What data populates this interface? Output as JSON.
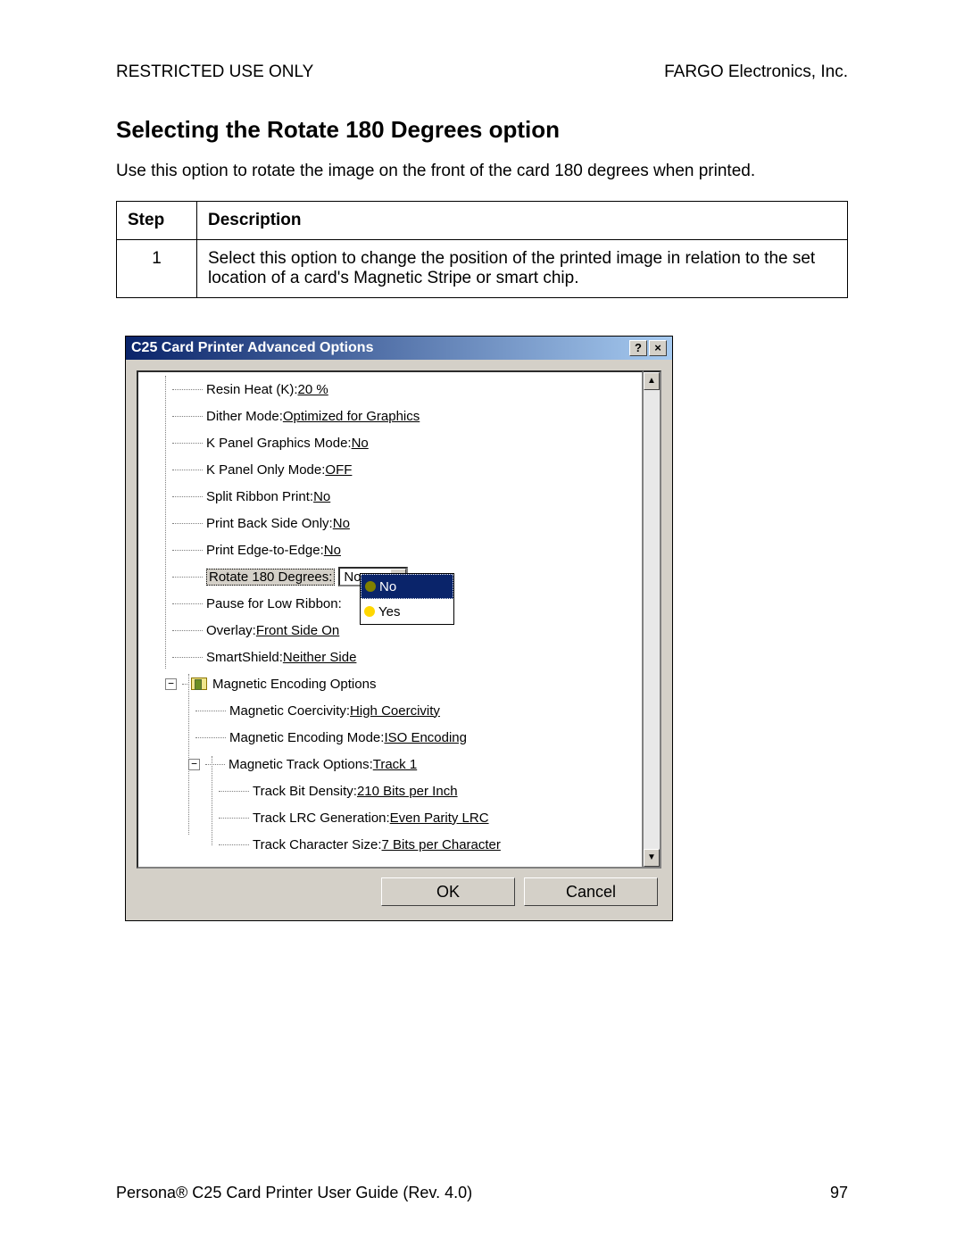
{
  "header": {
    "left": "RESTRICTED USE ONLY",
    "right": "FARGO Electronics, Inc."
  },
  "title": "Selecting the Rotate 180 Degrees option",
  "intro": "Use this option to rotate the image on the front of the card 180 degrees when printed.",
  "table": {
    "hdr_step": "Step",
    "hdr_desc": "Description",
    "row1_step": "1",
    "row1_desc": "Select this option to change the position of the printed image in relation to the set location of a card's Magnetic Stripe or smart chip."
  },
  "dialog": {
    "title": "C25 Card Printer Advanced Options",
    "help": "?",
    "close": "×",
    "scroll_up": "▲",
    "scroll_down": "▼",
    "expand": "−",
    "ok": "OK",
    "cancel": "Cancel",
    "combo_value": "No",
    "dropdown_no": "No",
    "dropdown_yes": "Yes",
    "nodes": {
      "n0_lbl": "Resin Heat (K): ",
      "n0_val": "20 %",
      "n1_lbl": "Dither Mode: ",
      "n1_val": "Optimized for Graphics",
      "n2_lbl": "K Panel Graphics Mode: ",
      "n2_val": "No",
      "n3_lbl": "K Panel Only Mode: ",
      "n3_val": "OFF",
      "n4_lbl": "Split Ribbon Print: ",
      "n4_val": "No",
      "n5_lbl": "Print Back Side Only: ",
      "n5_val": "No",
      "n6_lbl": "Print Edge-to-Edge: ",
      "n6_val": "No",
      "n7_lbl": "Rotate 180 Degrees:",
      "n8_lbl": "Pause for Low Ribbon:",
      "n9_lbl": "Overlay: ",
      "n9_val": "Front Side On",
      "n10_lbl": "SmartShield: ",
      "n10_val": "Neither Side",
      "n11_lbl": "Magnetic Encoding Options",
      "n12_lbl": "Magnetic Coercivity: ",
      "n12_val": "High Coercivity",
      "n13_lbl": "Magnetic Encoding Mode: ",
      "n13_val": "ISO Encoding",
      "n14_lbl": "Magnetic Track Options: ",
      "n14_val": "Track 1",
      "n15_lbl": "Track Bit Density: ",
      "n15_val": "210 Bits per Inch",
      "n16_lbl": "Track LRC Generation: ",
      "n16_val": "Even Parity LRC",
      "n17_lbl": "Track Character Size: ",
      "n17_val": "7 Bits per Character"
    }
  },
  "footer": {
    "left": "Persona® C25 Card Printer User Guide (Rev. 4.0)",
    "right": "97"
  }
}
